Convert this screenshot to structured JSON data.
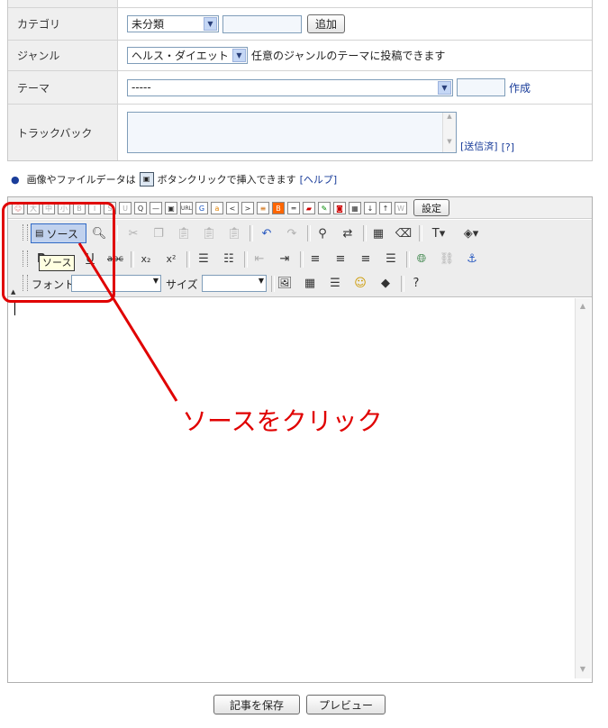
{
  "form": {
    "category": {
      "label": "カテゴリ",
      "selected": "未分類",
      "input_value": "",
      "add_button": "追加"
    },
    "genre": {
      "label": "ジャンル",
      "selected": "ヘルス・ダイエット",
      "note": "任意のジャンルのテーマに投稿できます"
    },
    "theme": {
      "label": "テーマ",
      "selected": "-----",
      "input_value": "",
      "create_link": "作成"
    },
    "trackback": {
      "label": "トラックバック",
      "value": "",
      "sent_link": "[送信済]",
      "help_link": "[?]"
    }
  },
  "hint": {
    "text": "画像やファイルデータは",
    "text2": "ボタンクリックで挿入できます",
    "help_link": "[ヘルプ]"
  },
  "top_toolbar": {
    "settings_button": "設定"
  },
  "editor_toolbar": {
    "source_button": "ソース",
    "tooltip": "ソース",
    "font_label": "フォント",
    "size_label": "サイズ",
    "font_value": "",
    "size_value": ""
  },
  "annotation": {
    "text": "ソースをクリック",
    "color": "#e00000"
  },
  "footer": {
    "save_button": "記事を保存",
    "preview_button": "プレビュー"
  }
}
